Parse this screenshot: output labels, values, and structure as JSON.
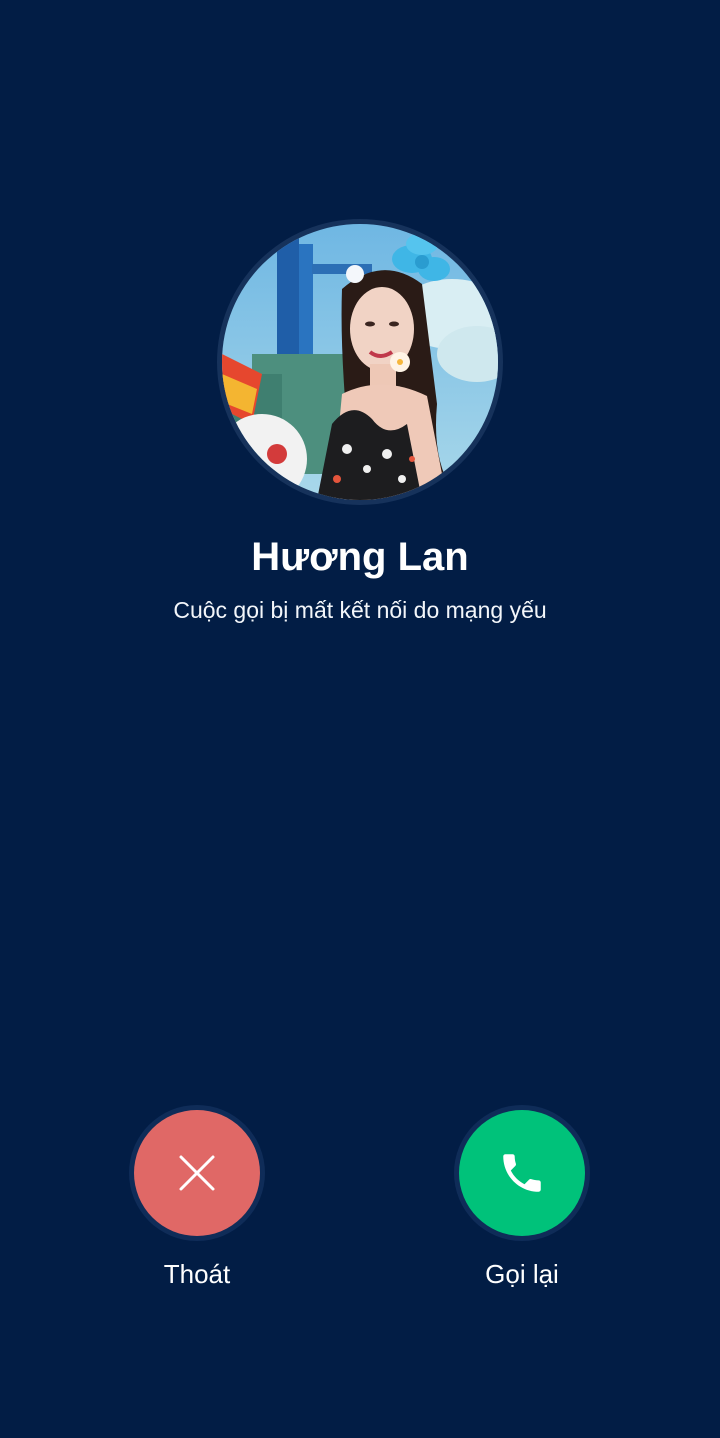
{
  "contact": {
    "name": "Hương Lan",
    "status": "Cuộc gọi bị mất kết nối do mạng yếu"
  },
  "actions": {
    "exit_label": "Thoát",
    "redial_label": "Gọi lại"
  },
  "icons": {
    "exit": "close-icon",
    "redial": "phone-icon"
  },
  "colors": {
    "background": "#021d45",
    "exit_button": "#e06866",
    "redial_button": "#00c27a",
    "text": "#ffffff"
  }
}
